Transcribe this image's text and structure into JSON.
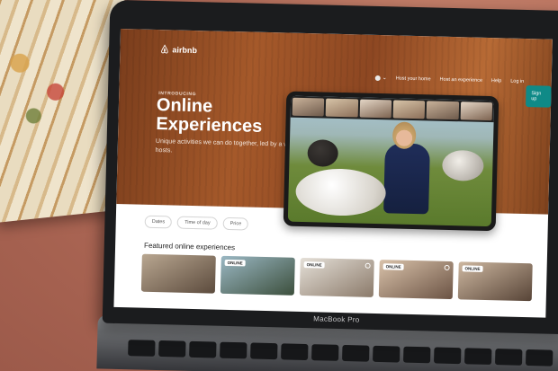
{
  "device": {
    "label": "MacBook Pro"
  },
  "nav": {
    "brand": "airbnb",
    "links": [
      "Host your home",
      "Host an experience",
      "Help",
      "Log in"
    ],
    "signup": "Sign up"
  },
  "hero": {
    "eyebrow": "INTRODUCING",
    "headline": "Online Experiences",
    "subtitle": "Unique activities we can do together, led by a world of hosts."
  },
  "filters": [
    "Dates",
    "Time of day",
    "Price"
  ],
  "featured": {
    "title": "Featured online experiences",
    "badge": "ONLINE",
    "cards": 5
  },
  "colors": {
    "brand_teal": "#0f8a87",
    "hero_wood": "#a5592a"
  },
  "icons": [
    "airbnb-logo-icon",
    "globe-icon",
    "chevron-down-icon",
    "heart-icon"
  ]
}
